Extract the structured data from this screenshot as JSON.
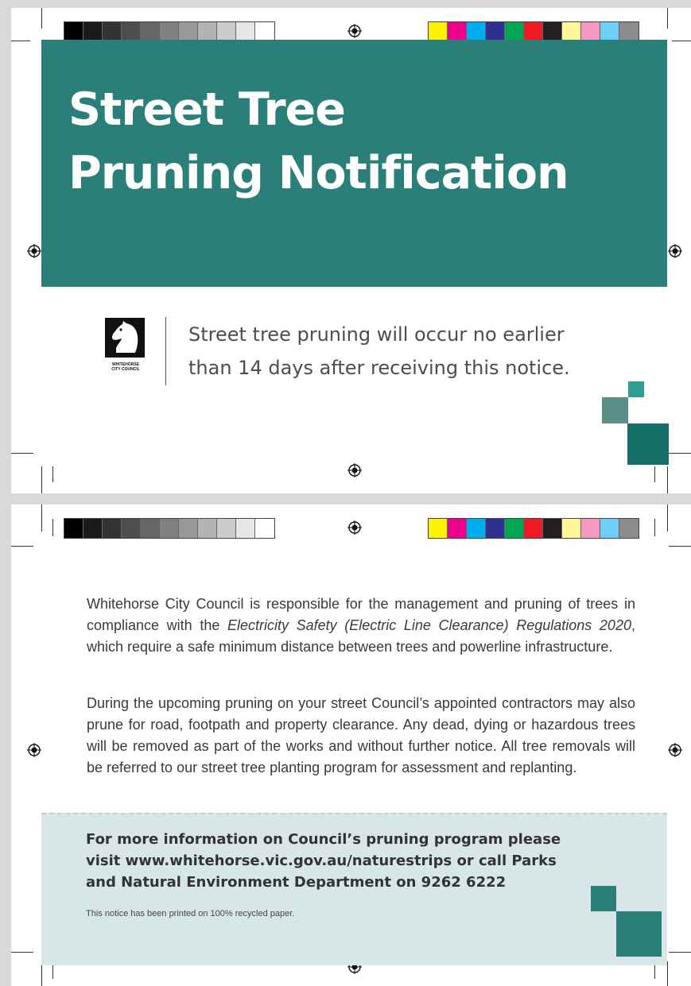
{
  "colors": {
    "banner": "#2a8079",
    "info_box": "#d8e6e8",
    "accent_dark": "#167067",
    "accent_mid": "#5a8f88",
    "accent_light": "#2f9b93"
  },
  "gray_bar": [
    "#000000",
    "#1a1a1a",
    "#333333",
    "#4d4d4d",
    "#666666",
    "#808080",
    "#999999",
    "#b3b3b3",
    "#cccccc",
    "#e6e6e6",
    "#ffffff"
  ],
  "color_bar": [
    "#fff200",
    "#ec008c",
    "#00aeef",
    "#2e3192",
    "#00a651",
    "#ed1c24",
    "#231f20",
    "#fff799",
    "#f49ac1",
    "#6dcff6",
    "#8c8c8c"
  ],
  "front": {
    "title_line1": "Street Tree",
    "title_line2": "Pruning Notification",
    "logo_icon": "chess-knight-icon",
    "logo_line1": "WHITEHORSE",
    "logo_line2": "CITY COUNCIL",
    "notice_line1": "Street tree pruning will occur no earlier",
    "notice_line2": "than 14 days after receiving this notice."
  },
  "back": {
    "para1_a": "Whitehorse City Council is responsible for the management and pruning of trees in compliance with the ",
    "para1_italic": "Electricity Safety (Electric Line Clearance) Regulations 2020",
    "para1_b": ", which require a safe minimum distance between trees and powerline infrastructure.",
    "para2": "During the upcoming pruning on your street Council’s appointed contractors may also prune for road, footpath and property clearance. Any dead, dying or hazardous trees will be removed as part of the works and without further notice. All tree removals will be referred to our street tree planting program for assessment and replanting.",
    "info_line1": "For more information on Council’s pruning program please",
    "info_line2": "visit www.whitehorse.vic.gov.au/naturestrips or call Parks",
    "info_line3": "and Natural Environment Department on 9262 6222",
    "recycled": "This notice has been printed on 100% recycled paper."
  }
}
